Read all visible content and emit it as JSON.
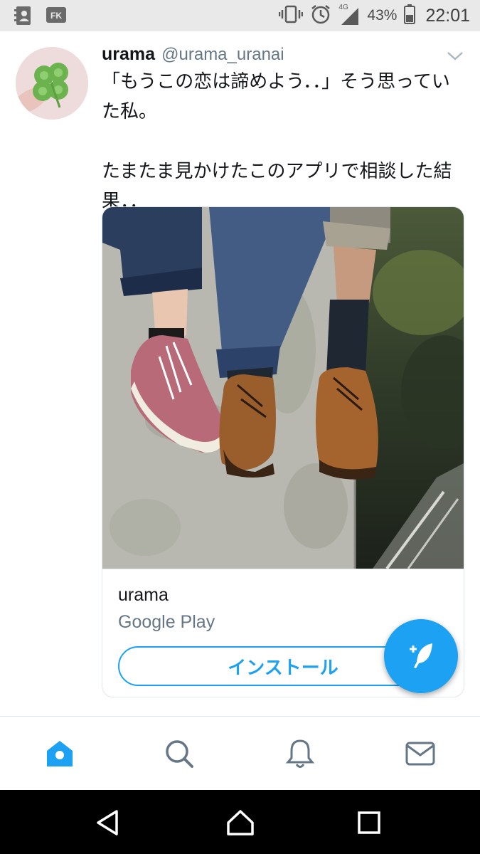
{
  "status_bar": {
    "battery": "43%",
    "time": "22:01",
    "network": "4G",
    "icons": [
      "contacts-icon",
      "fk-app-icon",
      "vibrate-icon",
      "alarm-icon",
      "signal-icon",
      "battery-icon"
    ]
  },
  "tweet": {
    "author_name": "urama",
    "author_handle": "@urama_uranai",
    "text": "「もうこの恋は諦めよう．．」そう思っていた私。\n\nたまたま見かけたこのアプリで相談した結果．．"
  },
  "card": {
    "title": "urama",
    "source": "Google Play",
    "install_label": "インストール"
  },
  "bottom_nav": [
    "home-icon",
    "search-icon",
    "notifications-icon",
    "messages-icon"
  ],
  "colors": {
    "accent": "#1da1f2",
    "text": "#14171a",
    "secondary_text": "#657786",
    "status_bar_bg": "#e9e9e9"
  }
}
